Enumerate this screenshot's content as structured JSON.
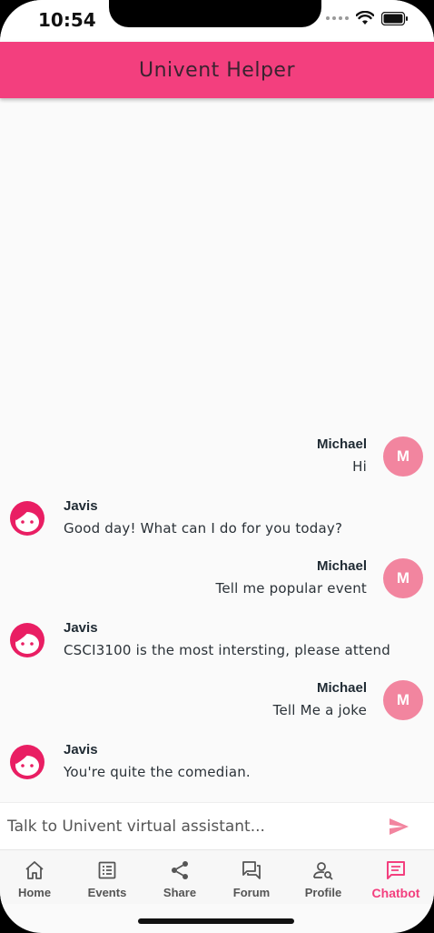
{
  "status_bar": {
    "time": "10:54"
  },
  "app": {
    "title": "Univent Helper"
  },
  "colors": {
    "accent": "#f33f7e",
    "user_avatar": "#f2859f",
    "bot_face": "#e91e63"
  },
  "messages": [
    {
      "sender": "Michael",
      "role": "user",
      "avatar_initial": "M",
      "text": "Hi"
    },
    {
      "sender": "Javis",
      "role": "bot",
      "avatar_icon": "girl-face-icon",
      "text": "Good day! What can I do for you today?"
    },
    {
      "sender": "Michael",
      "role": "user",
      "avatar_initial": "M",
      "text": "Tell me popular event"
    },
    {
      "sender": "Javis",
      "role": "bot",
      "avatar_icon": "girl-face-icon",
      "text": "CSCI3100 is the most intersting, please attend"
    },
    {
      "sender": "Michael",
      "role": "user",
      "avatar_initial": "M",
      "text": "Tell Me a joke"
    },
    {
      "sender": "Javis",
      "role": "bot",
      "avatar_icon": "girl-face-icon",
      "text": "You're quite the comedian."
    }
  ],
  "composer": {
    "placeholder": "Talk to Univent virtual assistant...",
    "value": "",
    "send_icon": "send-icon"
  },
  "bottom_nav": [
    {
      "label": "Home",
      "icon": "home-icon",
      "active": false
    },
    {
      "label": "Events",
      "icon": "events-icon",
      "active": false
    },
    {
      "label": "Share",
      "icon": "share-icon",
      "active": false
    },
    {
      "label": "Forum",
      "icon": "forum-icon",
      "active": false
    },
    {
      "label": "Profile",
      "icon": "profile-icon",
      "active": false
    },
    {
      "label": "Chatbot",
      "icon": "chatbot-icon",
      "active": true
    }
  ]
}
